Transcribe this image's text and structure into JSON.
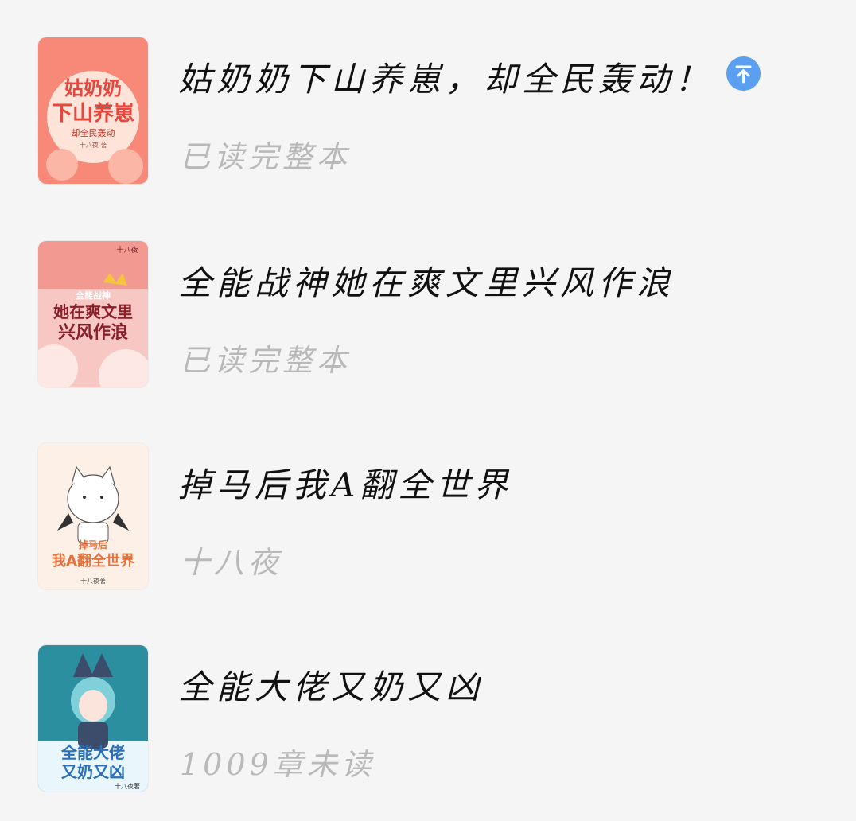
{
  "books": [
    {
      "title": "姑奶奶下山养崽，却全民轰动！",
      "status": "已读完整本",
      "pinned": true,
      "pin_icon": "pin-top-icon",
      "cover": {
        "text_lines": [
          "姑奶奶",
          "下山养崽",
          "却全民轰动"
        ],
        "author": "十八夜",
        "accent": "#f26a5c"
      }
    },
    {
      "title": "全能战神她在爽文里兴风作浪",
      "status": "已读完整本",
      "pinned": false,
      "cover": {
        "text_lines": [
          "全能战神",
          "她在爽文里",
          "兴风作浪"
        ],
        "author": "十八夜",
        "accent": "#8a1f2a"
      }
    },
    {
      "title": "掉马后我A翻全世界",
      "status": "十八夜",
      "pinned": false,
      "cover": {
        "text_lines": [
          "掉马后",
          "我A翻全世界"
        ],
        "author": "十八夜著",
        "accent": "#e8703a"
      }
    },
    {
      "title": "全能大佬又奶又凶",
      "status": "1009章未读",
      "pinned": false,
      "cover": {
        "text_lines": [
          "全能大佬",
          "又奶又凶"
        ],
        "author": "十八夜著",
        "accent": "#2a6fb8"
      }
    }
  ],
  "colors": {
    "background": "#f5f5f5",
    "title": "#111111",
    "subtitle": "#b9b9b9",
    "pin": "#5a9ff0"
  }
}
